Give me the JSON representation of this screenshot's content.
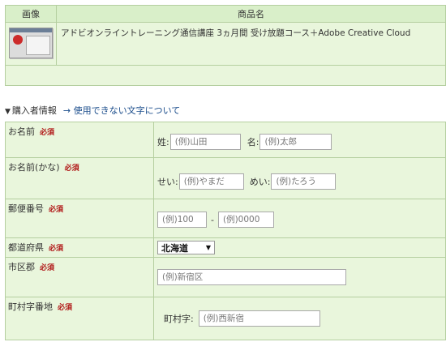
{
  "product_table": {
    "header_image": "画像",
    "header_name": "商品名",
    "product_name": "アドビオンライントレーニング通信講座 3ヵ月間 受け放題コース＋Adobe Creative Cloud"
  },
  "purchaser": {
    "heading": "購入者情報",
    "link": "→ 使用できない文字について"
  },
  "required_mark": "必須",
  "form": {
    "name": {
      "label": "お名前",
      "last_label": "姓:",
      "last_placeholder": "(例)山田",
      "first_label": "名:",
      "first_placeholder": "(例)太郎"
    },
    "kana": {
      "label": "お名前(かな)",
      "last_label": "せい:",
      "last_placeholder": "(例)やまだ",
      "first_label": "めい:",
      "first_placeholder": "(例)たろう"
    },
    "postal": {
      "label": "郵便番号",
      "first_placeholder": "(例)100",
      "separator": "-",
      "second_placeholder": "(例)0000"
    },
    "prefecture": {
      "label": "都道府県",
      "selected": "北海道"
    },
    "city": {
      "label": "市区郡",
      "placeholder": "(例)新宿区"
    },
    "town": {
      "label": "町村字番地",
      "sub_label": "町村字:",
      "placeholder": "(例)西新宿"
    }
  },
  "icons": {
    "section": "triangle-down-icon",
    "select": "chevron-down-icon"
  }
}
